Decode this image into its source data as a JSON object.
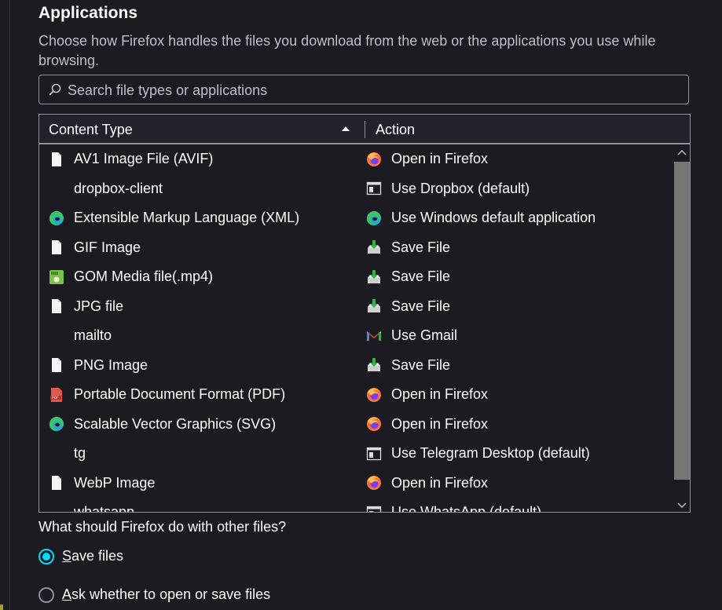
{
  "section": {
    "title": "Applications",
    "description": "Choose how Firefox handles the files you download from the web or the applications you use while browsing."
  },
  "search": {
    "placeholder": "Search file types or applications",
    "value": ""
  },
  "table": {
    "columns": {
      "content_type": "Content Type",
      "action": "Action",
      "sort": "ascending"
    },
    "rows": [
      {
        "type": "AV1 Image File (AVIF)",
        "type_icon": "file-icon",
        "action": "Open in Firefox",
        "action_icon": "firefox-icon"
      },
      {
        "type": "dropbox-client",
        "type_icon": "",
        "action": "Use Dropbox (default)",
        "action_icon": "app-window-icon"
      },
      {
        "type": "Extensible Markup Language (XML)",
        "type_icon": "edge-icon",
        "action": "Use Windows default application",
        "action_icon": "edge-icon"
      },
      {
        "type": "GIF Image",
        "type_icon": "file-icon",
        "action": "Save File",
        "action_icon": "save-file-icon"
      },
      {
        "type": "GOM Media file(.mp4)",
        "type_icon": "mp4-icon",
        "action": "Save File",
        "action_icon": "save-file-icon"
      },
      {
        "type": "JPG file",
        "type_icon": "file-icon",
        "action": "Save File",
        "action_icon": "save-file-icon"
      },
      {
        "type": "mailto",
        "type_icon": "",
        "action": "Use Gmail",
        "action_icon": "gmail-icon"
      },
      {
        "type": "PNG Image",
        "type_icon": "file-icon",
        "action": "Save File",
        "action_icon": "save-file-icon"
      },
      {
        "type": "Portable Document Format (PDF)",
        "type_icon": "pdf-icon",
        "action": "Open in Firefox",
        "action_icon": "firefox-icon"
      },
      {
        "type": "Scalable Vector Graphics (SVG)",
        "type_icon": "edge-icon",
        "action": "Open in Firefox",
        "action_icon": "firefox-icon"
      },
      {
        "type": "tg",
        "type_icon": "",
        "action": "Use Telegram Desktop (default)",
        "action_icon": "app-window-icon"
      },
      {
        "type": "WebP Image",
        "type_icon": "file-icon",
        "action": "Open in Firefox",
        "action_icon": "firefox-icon"
      },
      {
        "type": "whatsapp",
        "type_icon": "",
        "action": "Use WhatsApp (default)",
        "action_icon": "app-window-icon"
      }
    ]
  },
  "other_files": {
    "question": "What should Firefox do with other files?",
    "options": [
      {
        "label": "Save files",
        "access_key": "S",
        "rest": "ave files",
        "selected": true
      },
      {
        "label": "Ask whether to open or save files",
        "access_key": "A",
        "rest": "sk whether to open or save files",
        "selected": false
      }
    ]
  },
  "colors": {
    "background": "#1c1b22",
    "accent": "#00ddff",
    "border": "#8f8f9d",
    "text": "#fbfbfe"
  }
}
